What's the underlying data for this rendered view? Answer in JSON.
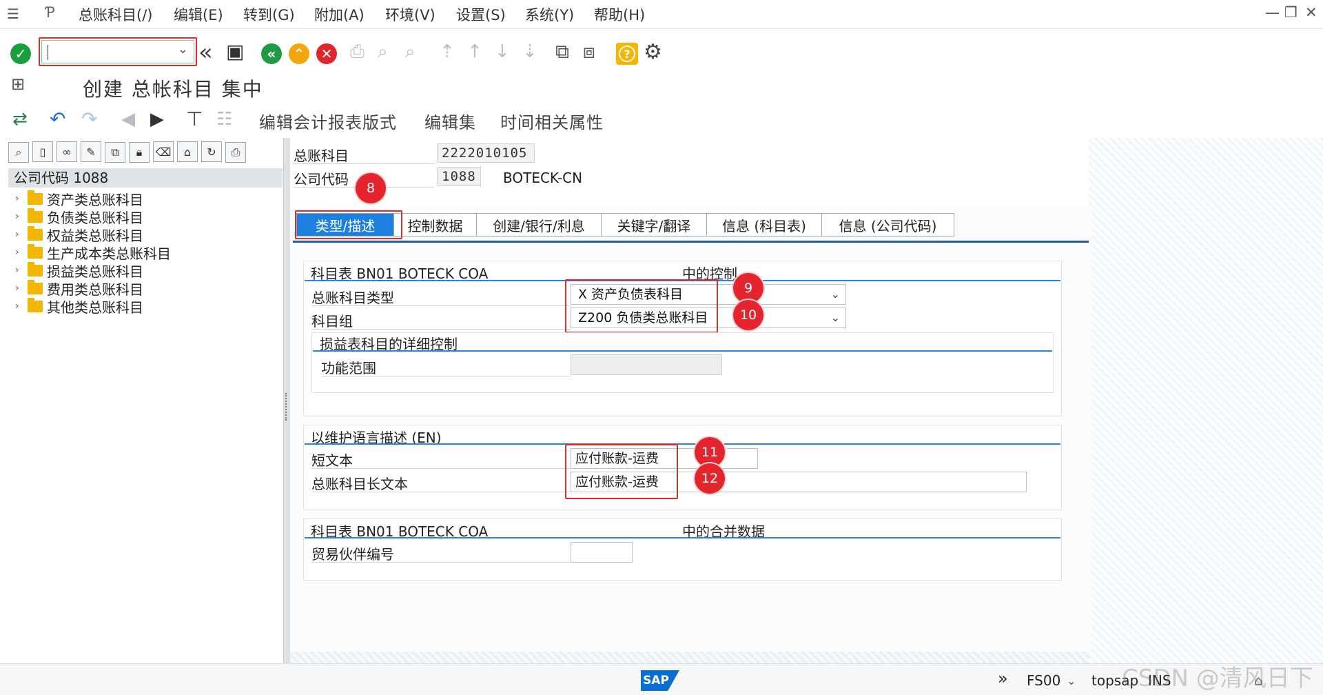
{
  "menubar": {
    "items": [
      "总账科目(/)",
      "编辑(E)",
      "转到(G)",
      "附加(A)",
      "环境(V)",
      "设置(S)",
      "系统(Y)",
      "帮助(H)"
    ],
    "window_controls": [
      "—",
      "❐",
      "✕"
    ]
  },
  "toolbar": {
    "command_value": "",
    "back_icon": "«"
  },
  "title": "创建 总帐科目 集中",
  "app_toolbar": {
    "items": [
      "编辑会计报表版式",
      "编辑集",
      "时间相关属性"
    ]
  },
  "tree": {
    "header": "公司代码 1088",
    "items": [
      "资产类总账科目",
      "负债类总账科目",
      "权益类总账科目",
      "生产成本类总账科目",
      "损益类总账科目",
      "费用类总账科目",
      "其他类总账科目"
    ]
  },
  "header_fields": {
    "gl_account_label": "总账科目",
    "gl_account_value": "2222010105",
    "company_code_label": "公司代码",
    "company_code_value": "1088",
    "company_name": "BOTECK-CN"
  },
  "tabs": [
    "类型/描述",
    "控制数据",
    "创建/银行/利息",
    "关键字/翻译",
    "信息 (科目表)",
    "信息 (公司代码)"
  ],
  "control_group": {
    "title_left": "科目表 BN01 BOTECK COA",
    "title_right": "中的控制",
    "account_type_label": "总账科目类型",
    "account_type_value": "X 资产负债表科目",
    "account_group_label": "科目组",
    "account_group_value": "Z200 负债类总账科目",
    "pl_subgroup_title": "损益表科目的详细控制",
    "functional_area_label": "功能范围"
  },
  "desc_group": {
    "title": "以维护语言描述 (EN)",
    "short_text_label": "短文本",
    "short_text_value": "应付账款-运费",
    "long_text_label": "总账科目长文本",
    "long_text_value": "应付账款-运费"
  },
  "consol_group": {
    "title_left": "科目表 BN01 BOTECK COA",
    "title_right": "中的合并数据",
    "partner_label": "贸易伙伴编号"
  },
  "badges": [
    "8",
    "9",
    "10",
    "11",
    "12"
  ],
  "statusbar": {
    "logo": "SAP",
    "arrows": "»",
    "transaction": "FS00",
    "system": "topsap",
    "mode": "INS"
  },
  "watermark": "CSDN @清风日下",
  "colors": {
    "active_tab": "#1d7fe0",
    "badge": "#e4252d",
    "check_green": "#1a9e3c",
    "nav_green": "#1e9a45",
    "nav_orange": "#f2a60c",
    "cancel_red": "#e0262b",
    "help_yellow": "#f7b500"
  }
}
